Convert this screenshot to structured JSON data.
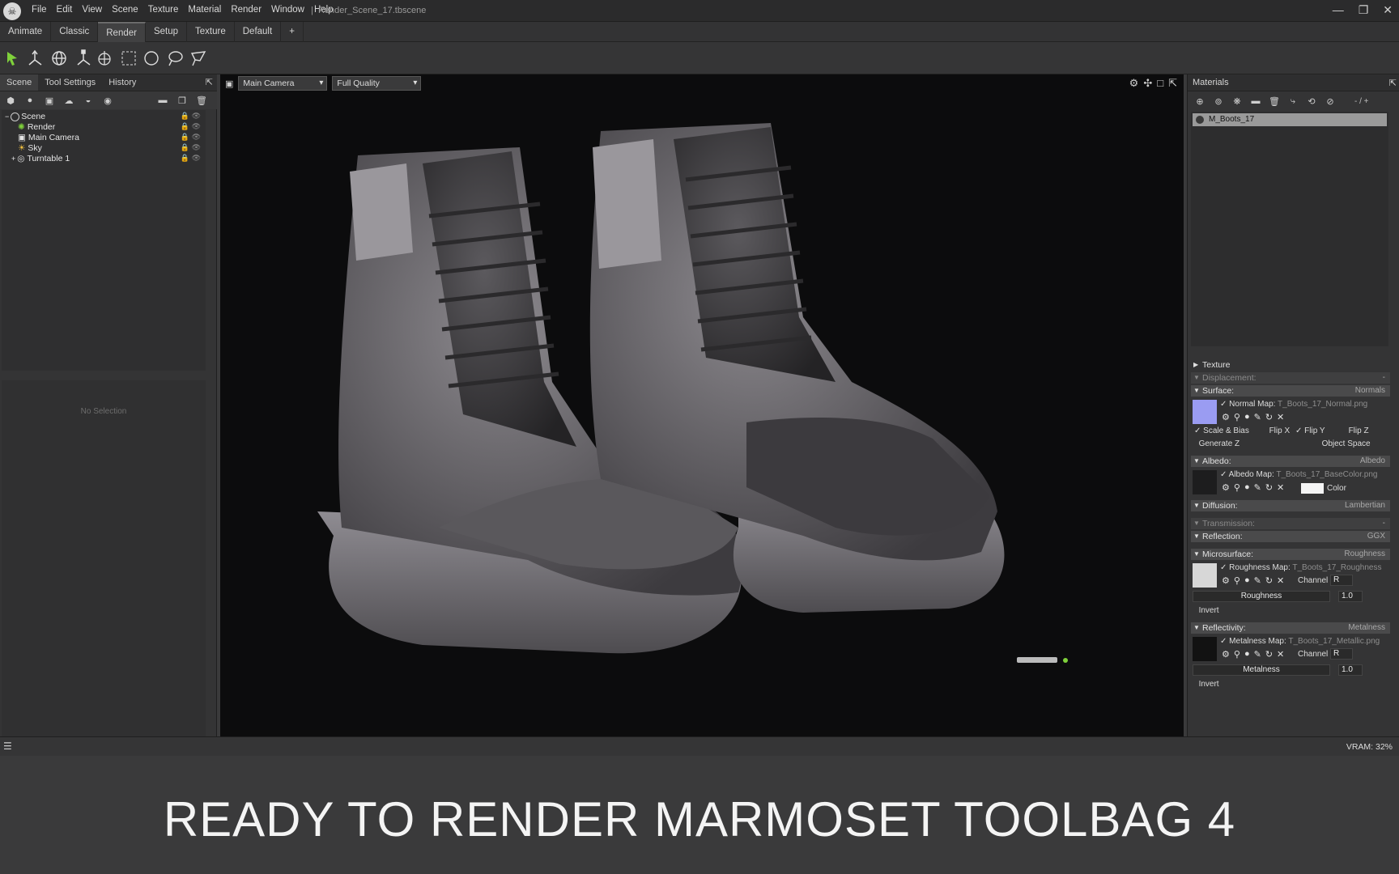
{
  "titlebar": {
    "logo_text": "☠",
    "menus": [
      "File",
      "Edit",
      "View",
      "Scene",
      "Texture",
      "Material",
      "Render",
      "Window",
      "Help"
    ],
    "separator": "|",
    "document": "Render_Scene_17.tbscene",
    "controls": [
      "—",
      "❐",
      "✕"
    ]
  },
  "tabs": {
    "items": [
      "Animate",
      "Classic",
      "Render",
      "Setup",
      "Texture",
      "Default",
      "+"
    ],
    "active": "Render"
  },
  "toolbar": {
    "tools": [
      "select-icon",
      "move-icon",
      "rotate-icon",
      "scale-icon",
      "transform-icon",
      "rect-select-icon",
      "ellipse-select-icon",
      "lasso-icon",
      "polygon-lasso-icon"
    ]
  },
  "left_panel": {
    "tabs": [
      "Scene",
      "Tool Settings",
      "History"
    ],
    "tree": [
      {
        "label": "Scene",
        "icon": "scene-icon",
        "indent": 0
      },
      {
        "label": "Render",
        "icon": "render-icon",
        "indent": 1
      },
      {
        "label": "Main Camera",
        "icon": "camera-icon",
        "indent": 1
      },
      {
        "label": "Sky",
        "icon": "sky-icon",
        "indent": 1
      },
      {
        "label": "Turntable 1",
        "icon": "turntable-icon",
        "indent": 1
      }
    ],
    "no_selection": "No Selection"
  },
  "viewport": {
    "camera": "Main Camera",
    "quality": "Full Quality"
  },
  "materials": {
    "title": "Materials",
    "counter": "- / +",
    "selected": "M_Boots_17",
    "sections": {
      "texture": "Texture",
      "displacement": {
        "label": "Displacement:",
        "value": "-"
      },
      "surface": {
        "label": "Surface:",
        "value": "Normals"
      },
      "normal_map": {
        "label": "Normal Map:",
        "file": "T_Boots_17_Normal.png"
      },
      "scale_bias": "Scale & Bias",
      "flip_x": "Flip X",
      "flip_y": "Flip Y",
      "flip_z": "Flip Z",
      "generate_z": "Generate Z",
      "object_space": "Object Space",
      "albedo": {
        "label": "Albedo:",
        "value": "Albedo"
      },
      "albedo_map": {
        "label": "Albedo Map:",
        "file": "T_Boots_17_BaseColor.png"
      },
      "color": "Color",
      "diffusion": {
        "label": "Diffusion:",
        "value": "Lambertian"
      },
      "transmission": {
        "label": "Transmission:",
        "value": "-"
      },
      "reflection": {
        "label": "Reflection:",
        "value": "GGX"
      },
      "microsurface": {
        "label": "Microsurface:",
        "value": "Roughness"
      },
      "roughness_map": {
        "label": "Roughness Map:",
        "file": "T_Boots_17_Roughness",
        "channel_label": "Channel",
        "channel": "R"
      },
      "roughness": {
        "label": "Roughness",
        "value": "1.0"
      },
      "invert": "Invert",
      "reflectivity": {
        "label": "Reflectivity:",
        "value": "Metalness"
      },
      "metalness_map": {
        "label": "Metalness Map:",
        "file": "T_Boots_17_Metallic.png",
        "channel_label": "Channel",
        "channel": "R"
      },
      "metalness": {
        "label": "Metalness",
        "value": "1.0"
      },
      "invert2": "Invert"
    }
  },
  "status": {
    "vram": "VRAM: 32%"
  },
  "caption": "READY TO RENDER  MARMOSET TOOLBAG 4"
}
